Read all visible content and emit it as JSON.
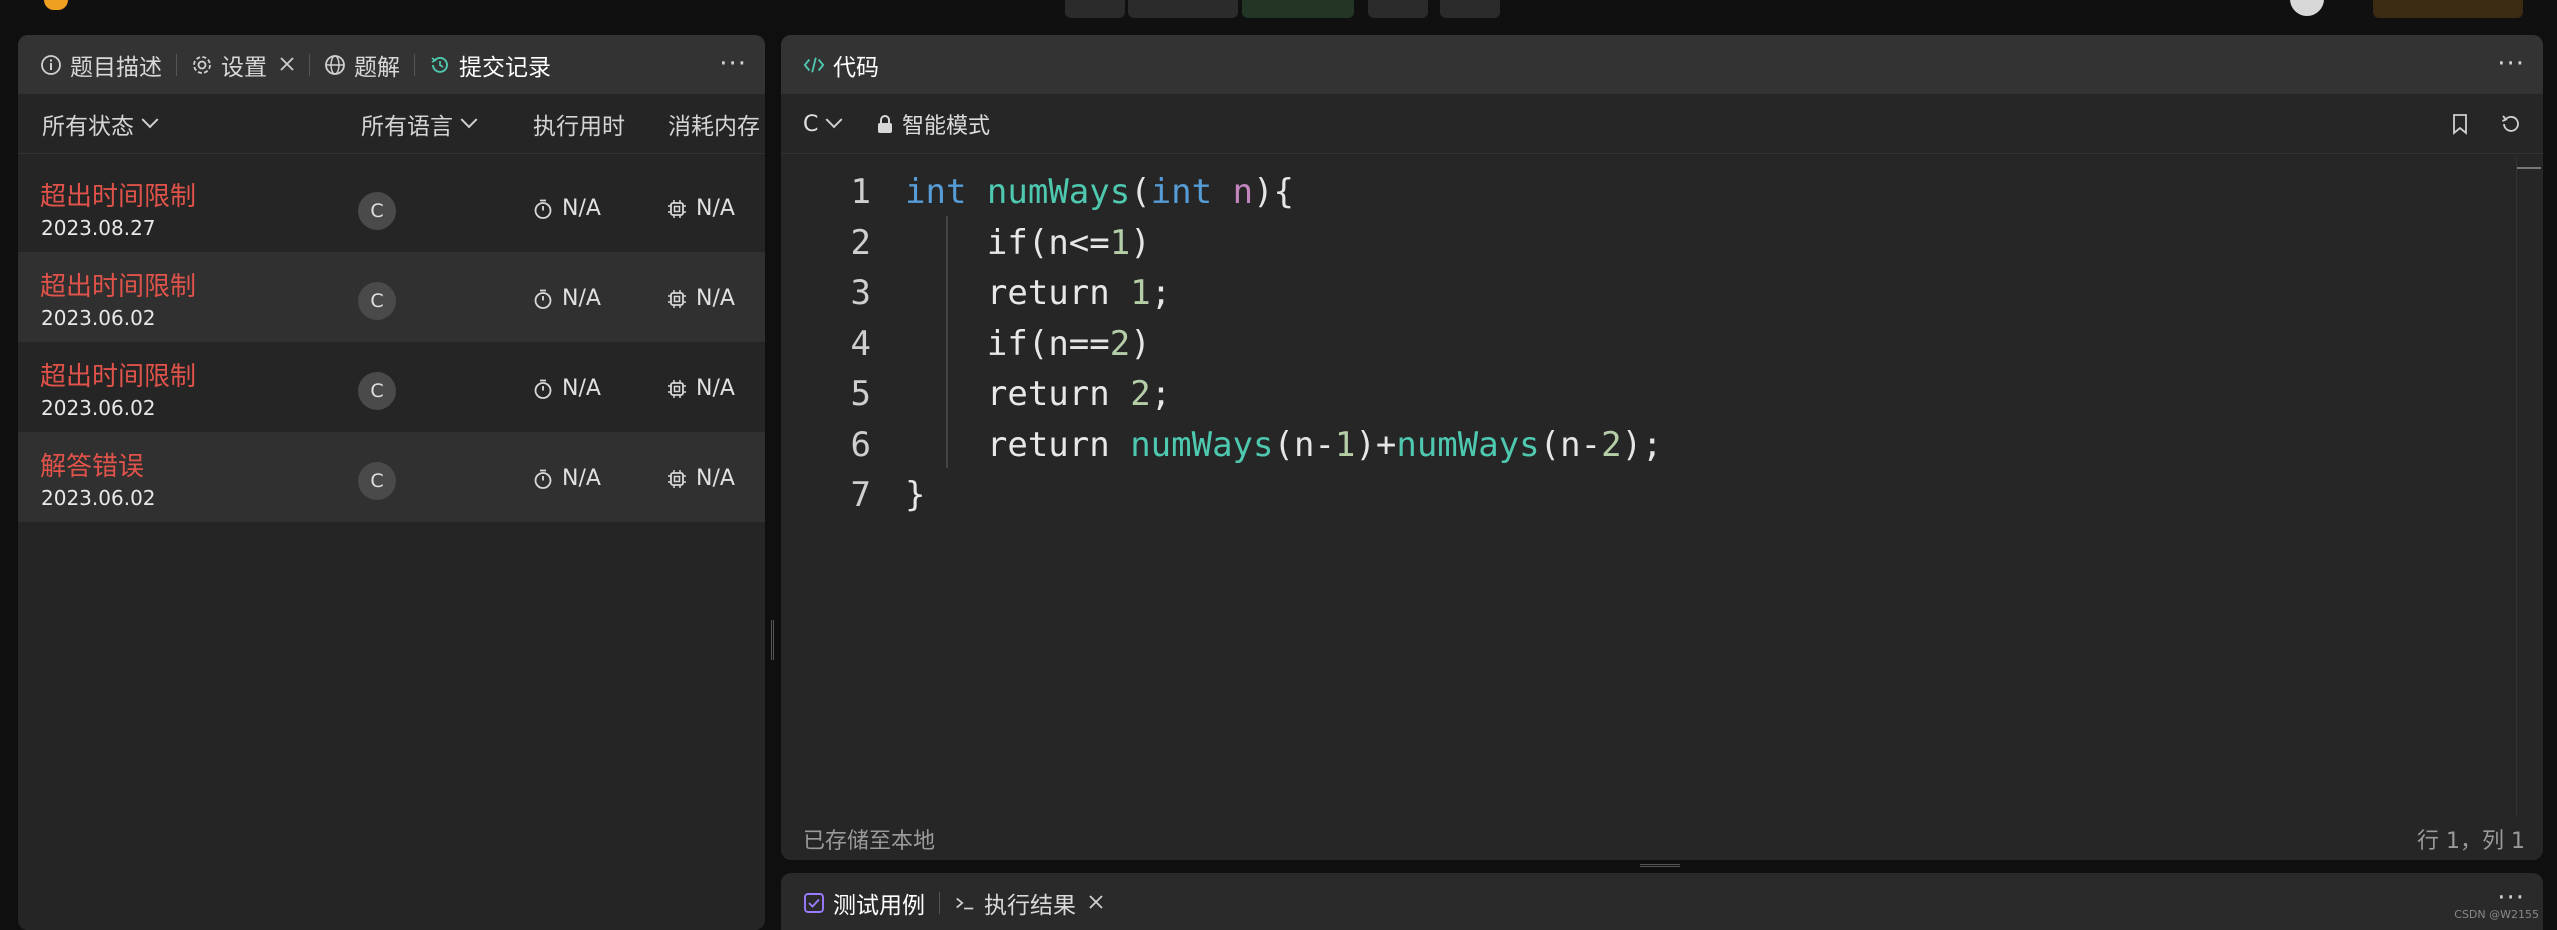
{
  "colors": {
    "accent_green": "#4ec9b0",
    "error_red": "#e0534a",
    "keyword_blue": "#569cd6",
    "param_purple": "#c586c0",
    "tab_icon_purple": "#9b7bff"
  },
  "left_panel": {
    "tabs": [
      {
        "label": "题目描述",
        "icon": "info-circle-icon"
      },
      {
        "label": "设置",
        "icon": "gear-icon",
        "closable": true
      },
      {
        "label": "题解",
        "icon": "globe-icon"
      },
      {
        "label": "提交记录",
        "icon": "history-icon",
        "active": true
      }
    ],
    "more_label": "···",
    "filters": {
      "status": "所有状态",
      "language": "所有语言",
      "runtime": "执行用时",
      "memory": "消耗内存"
    },
    "submissions": [
      {
        "status": "超出时间限制",
        "date": "2023.08.27",
        "lang": "C",
        "runtime": "N/A",
        "memory": "N/A"
      },
      {
        "status": "超出时间限制",
        "date": "2023.06.02",
        "lang": "C",
        "runtime": "N/A",
        "memory": "N/A"
      },
      {
        "status": "超出时间限制",
        "date": "2023.06.02",
        "lang": "C",
        "runtime": "N/A",
        "memory": "N/A"
      },
      {
        "status": "解答错误",
        "date": "2023.06.02",
        "lang": "C",
        "runtime": "N/A",
        "memory": "N/A"
      }
    ]
  },
  "editor": {
    "tab_label": "代码",
    "tab_icon": "code-icon",
    "more_label": "···",
    "language": "C",
    "mode": "智能模式",
    "line_numbers": [
      "1",
      "2",
      "3",
      "4",
      "5",
      "6",
      "7"
    ],
    "code_lines": [
      "int numWays(int n){",
      "    if(n<=1)",
      "    return 1;",
      "    if(n==2)",
      "    return 2;",
      "    return numWays(n-1)+numWays(n-2);",
      "}"
    ],
    "status_left": "已存储至本地",
    "status_right": "行 1，列 1"
  },
  "bottom_panel": {
    "tabs": [
      {
        "label": "测试用例",
        "icon": "checkbox-icon"
      },
      {
        "label": "执行结果",
        "icon": "terminal-icon",
        "closable": true
      }
    ],
    "more_label": "···"
  },
  "watermark": "CSDN @W2155"
}
